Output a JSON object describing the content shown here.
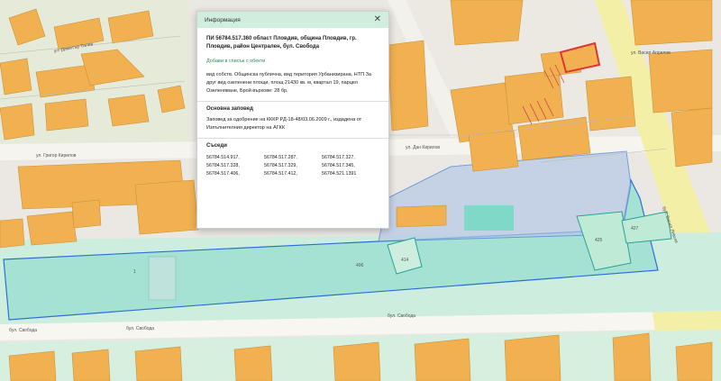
{
  "popup": {
    "title": "Информация",
    "close_icon": "close-icon",
    "heading": "ПИ 56784.517.360 област Пловдив, община Пловдив, гр. Пловдив, район Централен, бул. Свобода",
    "add_link": "Добави в списък с обекти",
    "description": "вид собств. Общинска публична, вид територия Урбанизирана, НТП За друг вид озеленени площи, площ 21430 кв. м, квартал 19, парцел Озеленяване, Брой върхове: 28 бр.",
    "order_title": "Основна заповед",
    "order_text": "Заповед за одобрение на КККР РД-18-48/03.06.2009 г., издадена от Изпълнителния директор на АГКК",
    "neighbors_title": "Съседи",
    "neighbors": [
      "56784.514.917,",
      "56784.517.287,",
      "56784.517.327,",
      "56784.517.328,",
      "56784.517.329,",
      "56784.517.345,",
      "56784.517.406,",
      "56784.517.412,",
      "56784.521.1391"
    ]
  },
  "map_labels": {
    "street_svoboda_1": "бул. Свобода",
    "street_svoboda_2": "бул. Свобода",
    "street_svoboda_3": "бул. Свобода",
    "street_dimitar": "ул. Димитър Талев",
    "street_grigor": "ул. Григор Кирилов",
    "street_vasil": "ул. Васил Априлов",
    "street_dan": "ул. Дан Кирилов",
    "street_boulevard_right": "бул. Васил Левски",
    "parcel_main": "1",
    "parcel_a": "414",
    "parcel_b": "425",
    "parcel_c": "427",
    "parcel_d": "406"
  },
  "colors": {
    "building": "#f2b150",
    "parcel_green": "#c6ebd7",
    "selected_fill": "#9fe1d2",
    "selected_border": "#2a6fd6",
    "highlight_red": "#e03535",
    "road_yellow": "#f4efa6",
    "popup_header": "#cfeedd"
  }
}
